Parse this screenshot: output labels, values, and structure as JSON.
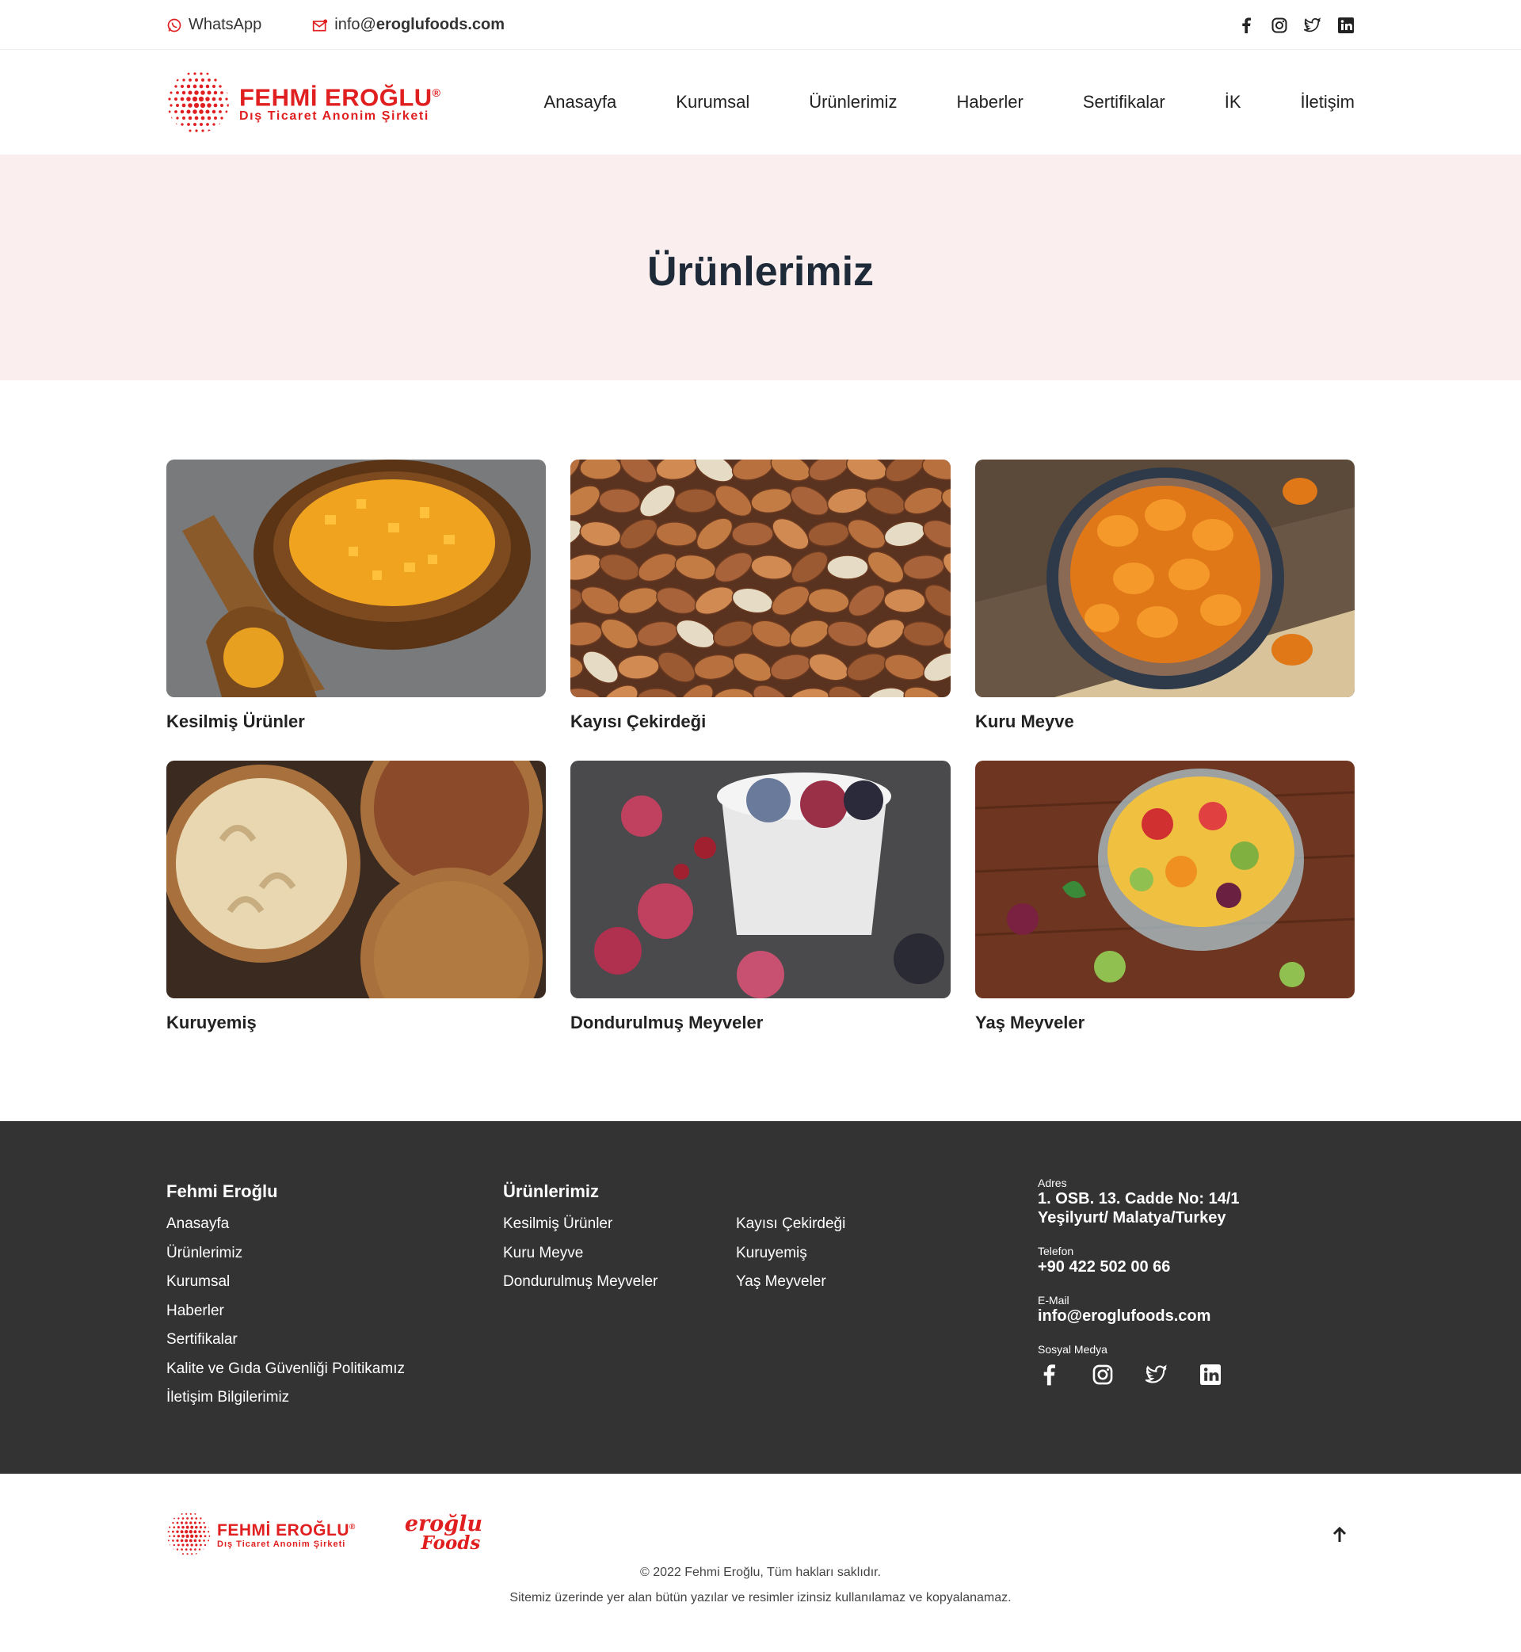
{
  "topbar": {
    "whatsapp_label": "WhatsApp",
    "email_prefix": "info@",
    "email_domain": "eroglufoods.com",
    "social_icons": [
      "facebook-icon",
      "instagram-icon",
      "twitter-icon",
      "linkedin-icon"
    ]
  },
  "brand": {
    "name": "FEHMİ EROĞLU",
    "registered": "®",
    "subtitle": "Dış Ticaret Anonim Şirketi",
    "accent_color": "#e02020",
    "second_logo_line1": "eroğlu",
    "second_logo_line2": "Foods"
  },
  "nav": {
    "items": [
      "Anasayfa",
      "Kurumsal",
      "Ürünlerimiz",
      "Haberler",
      "Sertifikalar",
      "İK",
      "İletişim"
    ]
  },
  "hero": {
    "title": "Ürünlerimiz",
    "background_color": "#fbeeee"
  },
  "products": [
    {
      "title": "Kesilmiş Ürünler",
      "image": "diced-apricots-bowl"
    },
    {
      "title": "Kayısı Çekirdeği",
      "image": "almond-kernels"
    },
    {
      "title": "Kuru Meyve",
      "image": "dried-apricots-bowl"
    },
    {
      "title": "Kuruyemiş",
      "image": "nut-bowls"
    },
    {
      "title": "Dondurulmuş Meyveler",
      "image": "frozen-berries"
    },
    {
      "title": "Yaş Meyveler",
      "image": "fresh-fruit-salad"
    }
  ],
  "footer": {
    "col1_title": "Fehmi Eroğlu",
    "col1_links": [
      "Anasayfa",
      "Ürünlerimiz",
      "Kurumsal",
      "Haberler",
      "Sertifikalar",
      "Kalite ve Gıda Güvenliği Politikamız",
      "İletişim Bilgilerimiz"
    ],
    "col2_title": "Ürünlerimiz",
    "col2_links_a": [
      "Kesilmiş Ürünler",
      "Kuru Meyve",
      "Dondurulmuş Meyveler"
    ],
    "col2_links_b": [
      "Kayısı Çekirdeği",
      "Kuruyemiş",
      "Yaş Meyveler"
    ],
    "address_label": "Adres",
    "address_value": "1. OSB. 13. Cadde No: 14/1 Yeşilyurt/ Malatya/Turkey",
    "phone_label": "Telefon",
    "phone_value": "+90 422 502 00 66",
    "email_label": "E-Mail",
    "email_value": "info@eroglufoods.com",
    "social_label": "Sosyal Medya",
    "background_color": "#333333"
  },
  "bottom": {
    "copyright": "© 2022 Fehmi Eroğlu, Tüm hakları saklıdır.",
    "notice": "Sitemiz üzerinde yer alan bütün yazılar ve resimler izinsiz kullanılamaz ve kopyalanamaz."
  }
}
